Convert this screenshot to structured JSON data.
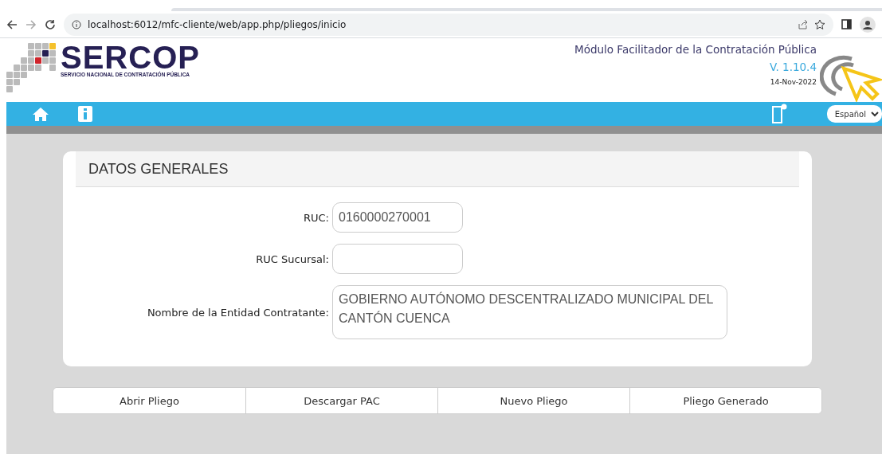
{
  "browser": {
    "url": "localhost:6012/mfc-cliente/web/app.php/pliegos/inicio"
  },
  "header": {
    "logo_title": "SERCOP",
    "logo_subtitle": "SERVICIO NACIONAL DE CONTRATACIÓN PÚBLICA",
    "app_title": "Módulo Facilitador de la Contratación Pública",
    "version": "V. 1.10.4",
    "date": "14-Nov-2022"
  },
  "nav": {
    "language": "Español"
  },
  "form": {
    "title": "DATOS GENERALES",
    "fields": [
      {
        "kind": "input",
        "label": "RUC:",
        "value": "0160000270001"
      },
      {
        "kind": "input",
        "label": "RUC Sucursal:"
      },
      {
        "kind": "textarea",
        "label": "Nombre de la Entidad Contratante:",
        "value": "GOBIERNO AUTÓNOMO DESCENTRALIZADO MUNICIPAL DEL CANTÓN CUENCA"
      }
    ]
  },
  "actions": [
    "Abrir Pliego",
    "Descargar PAC",
    "Nuevo Pliego",
    "Pliego Generado"
  ]
}
